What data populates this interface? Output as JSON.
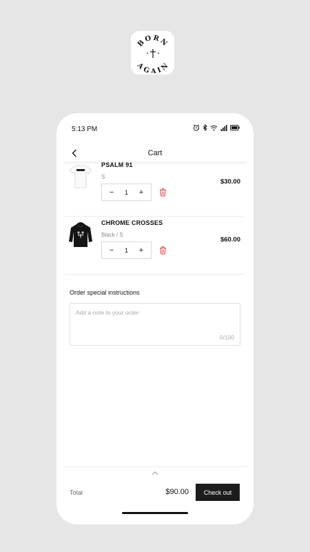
{
  "logo": {
    "top_text": "BORN",
    "bottom_text": "AGAIN",
    "icon": "cross-icon"
  },
  "status_bar": {
    "time": "5:13 PM",
    "icons": [
      "alarm-icon",
      "bluetooth-icon",
      "wifi-icon",
      "signal-icon",
      "battery-icon"
    ]
  },
  "nav": {
    "title": "Cart",
    "back_icon": "chevron-left-icon"
  },
  "cart": {
    "items": [
      {
        "name": "PSALM 91",
        "variant": "S",
        "quantity": "1",
        "price": "$30.00",
        "image": "white-tshirt",
        "minus": "−",
        "plus": "+"
      },
      {
        "name": "CHROME CROSSES",
        "variant": "Black / S",
        "quantity": "1",
        "price": "$60.00",
        "image": "black-hoodie",
        "minus": "−",
        "plus": "+"
      }
    ]
  },
  "instructions": {
    "title": "Order special instructions",
    "placeholder": "Add a note to your order",
    "value": "",
    "counter": "0/100"
  },
  "footer": {
    "total_label": "Total",
    "total_value": "$90.00",
    "checkout_label": "Check out"
  },
  "colors": {
    "background": "#e6e6e6",
    "checkout_bg": "#1c1c1c",
    "delete_red": "#e23b3b"
  }
}
